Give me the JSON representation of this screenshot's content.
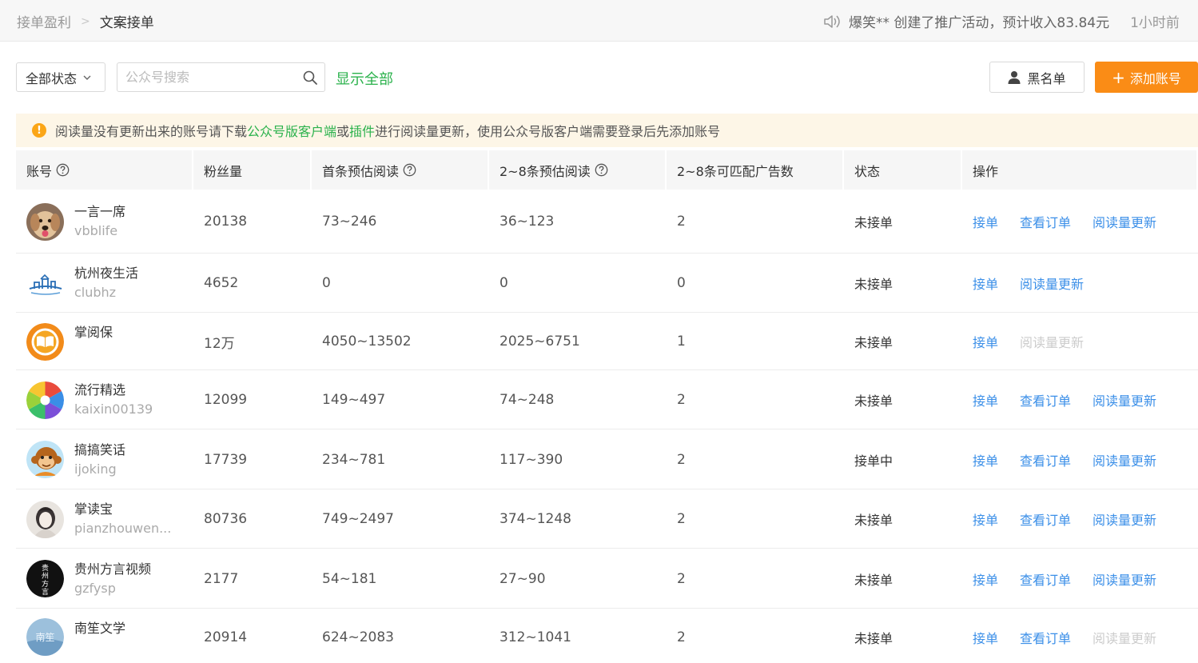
{
  "breadcrumb": {
    "parent": "接单盈利",
    "separator": ">",
    "current": "文案接单"
  },
  "notice": {
    "text": "爆笑** 创建了推广活动，预计收入83.84元",
    "time": "1小时前"
  },
  "toolbar": {
    "status_select": "全部状态",
    "search_placeholder": "公众号搜索",
    "show_all": "显示全部",
    "blacklist": "黑名单",
    "add_account": "添加账号"
  },
  "warning": {
    "part1": "阅读量没有更新出来的账号请下载",
    "link1": "公众号版客户端",
    "part2": "或",
    "link2": "插件",
    "part3": "进行阅读量更新，使用公众号版客户端需要登录后先添加账号"
  },
  "table": {
    "headers": [
      "账号",
      "粉丝量",
      "首条预估阅读",
      "2~8条预估阅读",
      "2~8条可匹配广告数",
      "状态",
      "操作"
    ],
    "rows": [
      {
        "name": "一言一席",
        "id": "vbblife",
        "fans": "20138",
        "first": "73~246",
        "second": "36~123",
        "ads": "2",
        "status": "未接单",
        "avatar": "dog",
        "ops": [
          {
            "label": "接单",
            "enabled": true
          },
          {
            "label": "查看订单",
            "enabled": true
          },
          {
            "label": "阅读量更新",
            "enabled": true
          }
        ]
      },
      {
        "name": "杭州夜生活",
        "id": "clubhz",
        "fans": "4652",
        "first": "0",
        "second": "0",
        "ads": "0",
        "status": "未接单",
        "avatar": "skyline",
        "ops": [
          {
            "label": "接单",
            "enabled": true
          },
          {
            "label": "阅读量更新",
            "enabled": true
          }
        ]
      },
      {
        "name": "掌阅保",
        "id": "",
        "fans": "12万",
        "first": "4050~13502",
        "second": "2025~6751",
        "ads": "1",
        "status": "未接单",
        "avatar": "book",
        "ops": [
          {
            "label": "接单",
            "enabled": true
          },
          {
            "label": "阅读量更新",
            "enabled": false
          }
        ]
      },
      {
        "name": "流行精选",
        "id": "kaixin00139",
        "fans": "12099",
        "first": "149~497",
        "second": "74~248",
        "ads": "2",
        "status": "未接单",
        "avatar": "pinwheel",
        "ops": [
          {
            "label": "接单",
            "enabled": true
          },
          {
            "label": "查看订单",
            "enabled": true
          },
          {
            "label": "阅读量更新",
            "enabled": true
          }
        ]
      },
      {
        "name": "搞搞笑话",
        "id": "ijoking",
        "fans": "17739",
        "first": "234~781",
        "second": "117~390",
        "ads": "2",
        "status": "接单中",
        "avatar": "monkey",
        "ops": [
          {
            "label": "接单",
            "enabled": true
          },
          {
            "label": "查看订单",
            "enabled": true
          },
          {
            "label": "阅读量更新",
            "enabled": true
          }
        ]
      },
      {
        "name": "掌读宝",
        "id": "pianzhouwen...",
        "fans": "80736",
        "first": "749~2497",
        "second": "374~1248",
        "ads": "2",
        "status": "未接单",
        "avatar": "girl",
        "ops": [
          {
            "label": "接单",
            "enabled": true
          },
          {
            "label": "查看订单",
            "enabled": true
          },
          {
            "label": "阅读量更新",
            "enabled": true
          }
        ]
      },
      {
        "name": "贵州方言视频",
        "id": "gzfysp",
        "fans": "2177",
        "first": "54~181",
        "second": "27~90",
        "ads": "2",
        "status": "未接单",
        "avatar": "guizhou",
        "ops": [
          {
            "label": "接单",
            "enabled": true
          },
          {
            "label": "查看订单",
            "enabled": true
          },
          {
            "label": "阅读量更新",
            "enabled": true
          }
        ]
      },
      {
        "name": "南笙文学",
        "id": "",
        "fans": "20914",
        "first": "624~2083",
        "second": "312~1041",
        "ads": "2",
        "status": "未接单",
        "avatar": "nansheng",
        "ops": [
          {
            "label": "接单",
            "enabled": true
          },
          {
            "label": "查看订单",
            "enabled": true
          },
          {
            "label": "阅读量更新",
            "enabled": false
          }
        ]
      }
    ]
  },
  "avatar_art": {
    "guizhou_chars": [
      "贵",
      "州",
      "方",
      "言"
    ],
    "nansheng_chars": "南笙"
  },
  "colors": {
    "accent_green": "#2bb24c",
    "link_blue": "#3b8fe8",
    "orange_button": "#fa8c16",
    "warning_bg": "#fdf6e7",
    "warning_icon": "#fba617"
  }
}
